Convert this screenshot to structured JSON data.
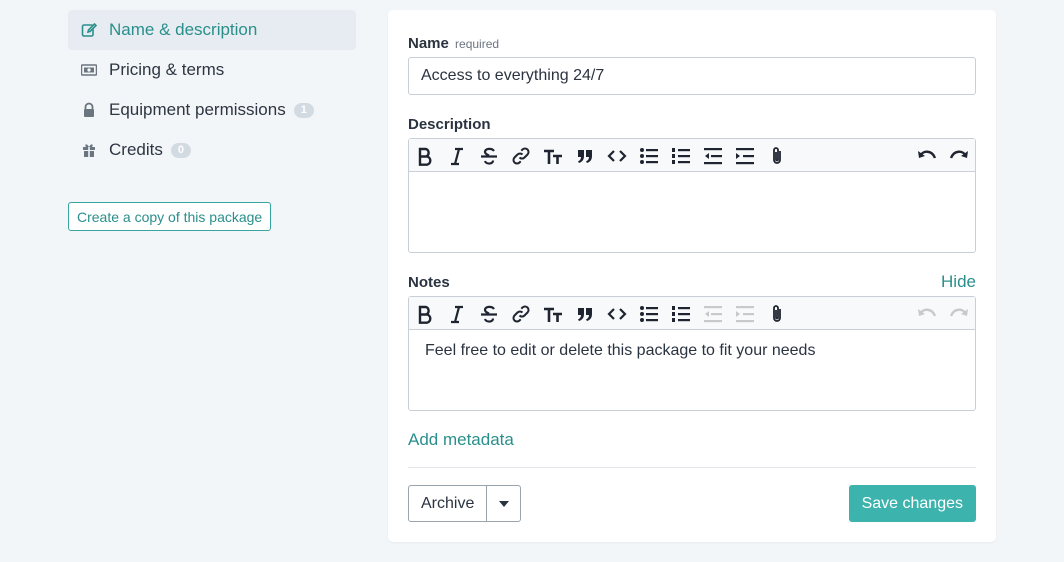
{
  "sidebar": {
    "items": [
      {
        "label": "Name & description",
        "icon": "edit-icon",
        "active": true
      },
      {
        "label": "Pricing & terms",
        "icon": "money-icon"
      },
      {
        "label": "Equipment permissions",
        "icon": "lock-icon",
        "badge": "1"
      },
      {
        "label": "Credits",
        "icon": "gift-icon",
        "badge": "0"
      }
    ],
    "copy_button": "Create a copy of this package"
  },
  "form": {
    "name_label": "Name",
    "name_required": "required",
    "name_value": "Access to everything 24/7",
    "description_label": "Description",
    "description_value": "",
    "notes_label": "Notes",
    "notes_toggle": "Hide",
    "notes_value": "Feel free to edit or delete this package to fit your needs",
    "add_metadata": "Add metadata",
    "archive_label": "Archive",
    "save_label": "Save changes"
  },
  "colors": {
    "accent": "#2a8f8b",
    "save_button": "#3cb3ad",
    "background": "#f3f6f9"
  }
}
